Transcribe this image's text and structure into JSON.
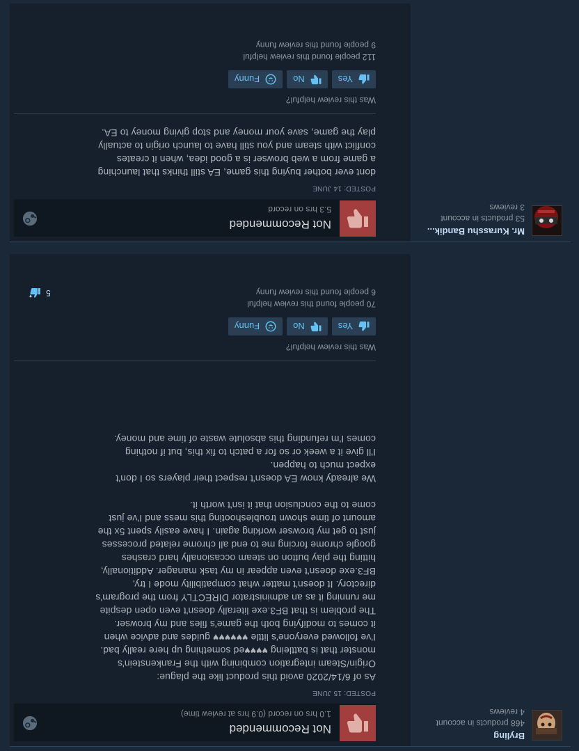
{
  "reviews": [
    {
      "author": {
        "name": "Bryling",
        "products": "468 products in account",
        "reviews": "4 reviews"
      },
      "recommendation": "Not Recommended",
      "hours": "1.0 hrs on record (0.9 hrs at review time)",
      "posted": "POSTED: 15 JUNE",
      "body": "As of 6/14/2020 avoid this product like the plague:\nOrigin/Steam integration combining with the Frankenstein's\nmonster that is battleing ♥♥♥♥ed something up here really bad.\nI've followed everyone's little ♥♥♥♥♥♥ guides and advice when\nit comes to modifying both the game's files and my browser.\nThe problem is that BF3.exe literally doesn't even open despite\nme running it as an administrator DIRECTLY from the program's\ndirectory. It doesn't matter what compatibility mode I try,\nBF3.exe doesn't even appear in my task manager. Additionally,\nhitting the play button on steam occasionally hard crashes\ngoogle chrome forcing me to end all chrome related processes\njust to get my browser working again. I have easily spent 5x the\namount of time shown troubleshooting this mess and I've just\ncome to the conclusion that it isn't worth it.\n\nWe already know EA doesn't respect their players so I don't\nexpect much to happen.\nI'll give it a week or so for a patch to fix this, but if nothing\ncomes I'm refunding this absolute waste of time and money.",
      "helpful_question": "Was this review helpful?",
      "votes": {
        "yes": "Yes",
        "no": "No",
        "funny": "Funny"
      },
      "helpful_count": "70 people found this review helpful",
      "funny_count": "6 people found this review funny",
      "award_count": "5"
    },
    {
      "author": {
        "name": "Mr. Kurasshu Bandik...",
        "products": "53 products in account",
        "reviews": "3 reviews"
      },
      "recommendation": "Not Recommended",
      "hours": "5.3 hrs on record",
      "posted": "POSTED: 14 JUNE",
      "body": "dont ever bother buying this game, EA still thinks that launching\na game from a web browser is a good idea, when it creates\nconflict with steam and you still have to launch origin to actually\nplay the game, save your money and stop giving money to EA.",
      "helpful_question": "Was this review helpful?",
      "votes": {
        "yes": "Yes",
        "no": "No",
        "funny": "Funny"
      },
      "helpful_count": "112 people found this review helpful",
      "funny_count": "9 people found this review funny"
    }
  ],
  "colors": {
    "background": "#1b2838",
    "review_panel": "#16202d",
    "not_recommended": "#a33e3e",
    "vote_button": "#2a3f53",
    "vote_text": "#66c0f4"
  }
}
